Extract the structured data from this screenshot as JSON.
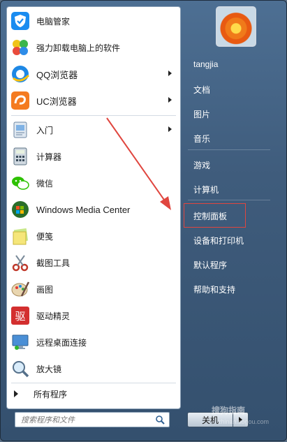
{
  "programs": [
    {
      "label": "电脑管家",
      "icon": "shield-icon",
      "submenu": false
    },
    {
      "label": "强力卸载电脑上的软件",
      "icon": "clover-icon",
      "submenu": false
    },
    {
      "label": "QQ浏览器",
      "icon": "qq-browser-icon",
      "submenu": true
    },
    {
      "label": "UC浏览器",
      "icon": "uc-browser-icon",
      "submenu": true
    },
    {
      "label": "入门",
      "icon": "getting-started-icon",
      "submenu": true
    },
    {
      "label": "计算器",
      "icon": "calculator-icon",
      "submenu": false
    },
    {
      "label": "微信",
      "icon": "wechat-icon",
      "submenu": false
    },
    {
      "label": "Windows Media Center",
      "icon": "media-center-icon",
      "submenu": false
    },
    {
      "label": "便笺",
      "icon": "sticky-notes-icon",
      "submenu": false
    },
    {
      "label": "截图工具",
      "icon": "snipping-tool-icon",
      "submenu": false
    },
    {
      "label": "画图",
      "icon": "paint-icon",
      "submenu": false
    },
    {
      "label": "驱动精灵",
      "icon": "driver-genius-icon",
      "submenu": false
    },
    {
      "label": "远程桌面连接",
      "icon": "remote-desktop-icon",
      "submenu": false
    },
    {
      "label": "放大镜",
      "icon": "magnifier-icon",
      "submenu": false
    }
  ],
  "all_programs": "所有程序",
  "search": {
    "placeholder": "搜索程序和文件"
  },
  "right_menu": [
    {
      "label": "tangjia"
    },
    {
      "label": "文档"
    },
    {
      "label": "图片"
    },
    {
      "label": "音乐"
    },
    {
      "label": "游戏"
    },
    {
      "label": "计算机"
    },
    {
      "label": "控制面板",
      "highlighted": true
    },
    {
      "label": "设备和打印机"
    },
    {
      "label": "默认程序"
    },
    {
      "label": "帮助和支持"
    }
  ],
  "shutdown": {
    "label": "关机"
  },
  "watermark": {
    "text": "搜狗指南",
    "sub": "zhinan.sogou.com"
  },
  "colors": {
    "annotation": "#e0463f",
    "panel_bg": "#3f5c7c"
  }
}
